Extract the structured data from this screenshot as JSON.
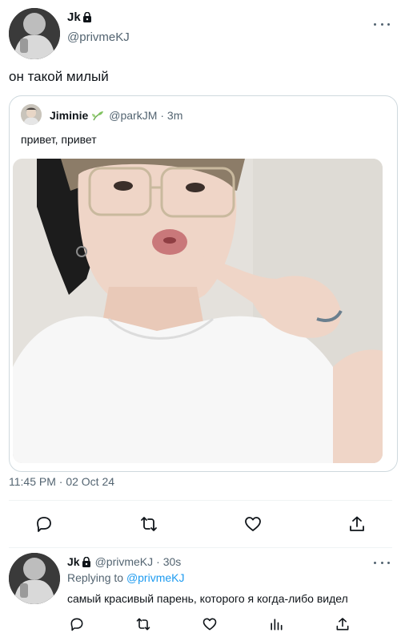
{
  "main_tweet": {
    "display_name": "Jk",
    "handle": "@privmeKJ",
    "text": "он такой милый",
    "timestamp": "11:45 PM · 02 Oct 24",
    "icons": {
      "lock": "lock-icon",
      "more": "more-icon"
    }
  },
  "quoted_tweet": {
    "display_name": "Jiminie",
    "handle": "@parkJM",
    "time": "· 3m",
    "text": "привет, привет",
    "icon": "sprout-icon"
  },
  "actions": {
    "main": [
      "reply-icon",
      "retweet-icon",
      "like-icon",
      "share-icon"
    ],
    "reply": [
      "reply-icon",
      "retweet-icon",
      "like-icon",
      "views-icon",
      "share-icon"
    ]
  },
  "reply_tweet": {
    "display_name": "Jk",
    "handle": "@privmeKJ",
    "time": "· 30s",
    "replying_prefix": "Replying to",
    "replying_to": "@privmeKJ",
    "text": "самый красивый парень, которого я когда-либо видел"
  },
  "colors": {
    "text": "#0f1419",
    "muted": "#536471",
    "accent": "#1d9bf0",
    "border": "#cfd9de",
    "sprout": "#7fc25e"
  }
}
